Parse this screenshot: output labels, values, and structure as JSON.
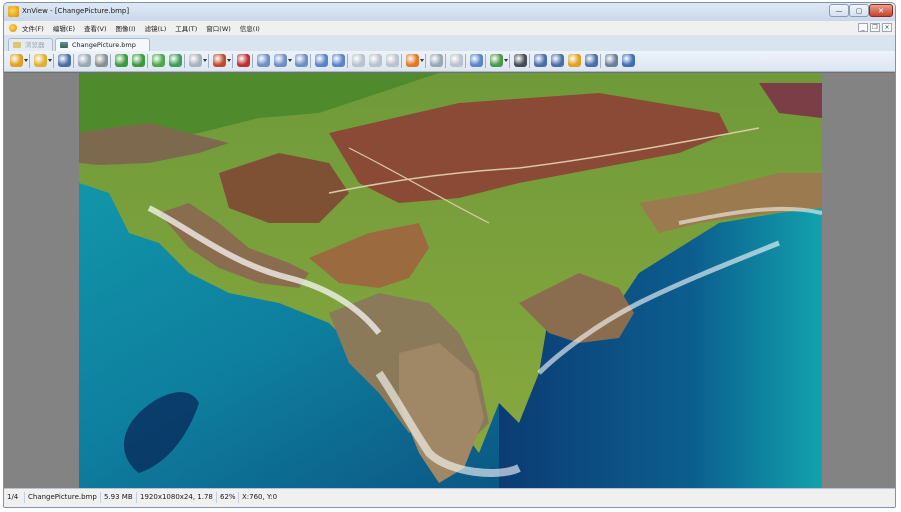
{
  "window": {
    "title": "XnView - [ChangePicture.bmp]",
    "controls": {
      "minimize": "—",
      "maximize": "▢",
      "close": "✕"
    }
  },
  "menubar": {
    "items": [
      {
        "label": "文件(F)"
      },
      {
        "label": "编辑(E)"
      },
      {
        "label": "查看(V)"
      },
      {
        "label": "图像(I)"
      },
      {
        "label": "滤镜(L)"
      },
      {
        "label": "工具(T)"
      },
      {
        "label": "窗口(W)"
      },
      {
        "label": "信息(I)"
      }
    ],
    "mdi_controls": {
      "minimize": "_",
      "restore": "❐",
      "close": "×"
    }
  },
  "tabs": [
    {
      "label": "浏览器",
      "state": "inactive"
    },
    {
      "label": "ChangePicture.bmp",
      "state": "active"
    }
  ],
  "toolbar": {
    "buttons": [
      {
        "icon": "browser-icon",
        "color": "#e0a020"
      },
      {
        "icon": "open-folder-icon",
        "color": "#e0b030"
      },
      {
        "icon": "save-icon",
        "color": "#4a6fa8"
      },
      {
        "icon": "print-preview-icon",
        "color": "#9aa7b5"
      },
      {
        "icon": "crop-icon",
        "color": "#8a8f95"
      },
      {
        "icon": "rotate-left-icon",
        "color": "#3c9a3c"
      },
      {
        "icon": "rotate-right-icon",
        "color": "#3c9a3c"
      },
      {
        "icon": "adjust-icon",
        "color": "#4aa84a"
      },
      {
        "icon": "resize-icon",
        "color": "#3f9c5a"
      },
      {
        "icon": "effects-icon",
        "color": "#a9b2bd"
      },
      {
        "icon": "filter-icon",
        "color": "#c24a2a"
      },
      {
        "icon": "red-eye-icon",
        "color": "#c03030"
      },
      {
        "icon": "zoom-in-icon",
        "color": "#6c8fc4"
      },
      {
        "icon": "zoom-out-icon",
        "color": "#6c8fc4"
      },
      {
        "icon": "zoom-fit-icon",
        "color": "#6c8fc4"
      },
      {
        "icon": "previous-icon",
        "color": "#5a84c8"
      },
      {
        "icon": "next-icon",
        "color": "#5a84c8"
      },
      {
        "icon": "first-icon",
        "color": "#b9c2cd"
      },
      {
        "icon": "last-icon",
        "color": "#b9c2cd"
      },
      {
        "icon": "copy-icon",
        "color": "#b9c2cd"
      },
      {
        "icon": "slideshow-icon",
        "color": "#e07a20"
      },
      {
        "icon": "fullscreen-icon",
        "color": "#9aa7b5"
      },
      {
        "icon": "delete-icon",
        "color": "#b9c2cd"
      },
      {
        "icon": "compare-icon",
        "color": "#5a84c8"
      },
      {
        "icon": "batch-icon",
        "color": "#4a9a4a"
      },
      {
        "icon": "binoculars-icon",
        "color": "#444c56"
      },
      {
        "icon": "printer-icon",
        "color": "#4a6fa8"
      },
      {
        "icon": "scanner-icon",
        "color": "#4a6fa8"
      },
      {
        "icon": "capture-icon",
        "color": "#e0a020"
      },
      {
        "icon": "convert-icon",
        "color": "#4a6fa8"
      },
      {
        "icon": "settings-icon",
        "color": "#6c7f99"
      },
      {
        "icon": "info-icon",
        "color": "#3d6fb8"
      }
    ]
  },
  "statusbar": {
    "fields": [
      {
        "label": "1/4"
      },
      {
        "label": "ChangePicture.bmp"
      },
      {
        "label": "5.93 MB"
      },
      {
        "label": "1920x1080x24, 1.78"
      },
      {
        "label": "62%"
      },
      {
        "label": "X:760, Y:0"
      }
    ]
  },
  "colors": {
    "viewer_background": "#838383",
    "window_frame": "#d9e4f1",
    "ocean_deep": "#0b3c73",
    "ocean_turquoise": "#139fae",
    "cliff": "#8a6d4e",
    "grass": "#7aa13a",
    "heather": "#8a4a36"
  }
}
